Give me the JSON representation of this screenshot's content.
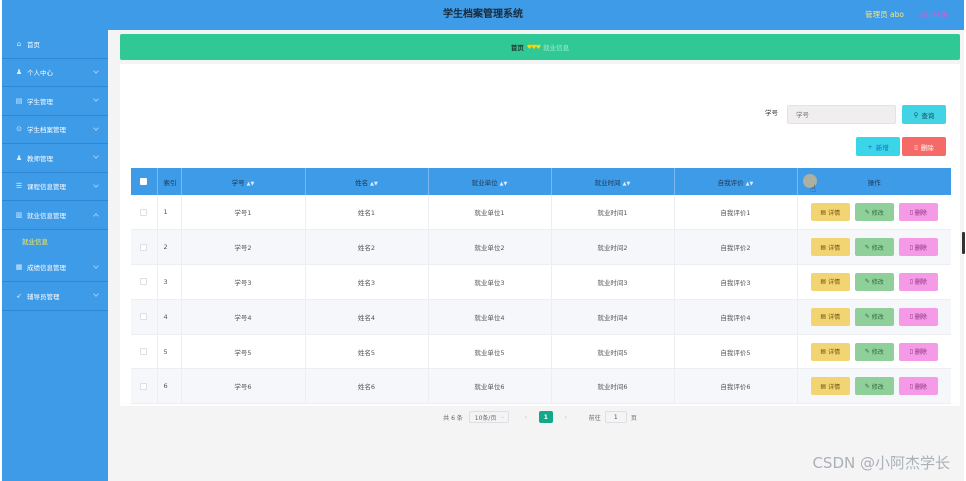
{
  "header": {
    "title": "学生档案管理系统",
    "user": "管理员 abo",
    "logout": "退出登录"
  },
  "sidebar": {
    "items": [
      {
        "label": "首页",
        "icon": "⌂"
      },
      {
        "label": "个人中心",
        "icon": "♟"
      },
      {
        "label": "学生管理",
        "icon": "▤"
      },
      {
        "label": "学生档案管理",
        "icon": "⊙"
      },
      {
        "label": "教师管理",
        "icon": "♟"
      },
      {
        "label": "课程信息管理",
        "icon": "☰"
      },
      {
        "label": "就业信息管理",
        "icon": "▥"
      }
    ],
    "sub_item": "就业信息",
    "items_after": [
      {
        "label": "成绩信息管理",
        "icon": "▦"
      },
      {
        "label": "辅导员管理",
        "icon": "➶"
      }
    ]
  },
  "breadcrumb": {
    "home": "首页",
    "current": "就业信息"
  },
  "search": {
    "label": "学号",
    "placeholder": "学号",
    "button": "查询"
  },
  "toolbar": {
    "add": "新增",
    "delete": "删除"
  },
  "table": {
    "columns": [
      "索引",
      "学号",
      "姓名",
      "就业单位",
      "就业时间",
      "自我评价",
      "操作"
    ],
    "actions": {
      "detail": "详情",
      "edit": "修改",
      "delete": "删除"
    },
    "rows": [
      {
        "index": "1",
        "student_no": "学号1",
        "name": "姓名1",
        "employer": "就业单位1",
        "employment_time": "就业时间1",
        "self_eval": "自我评价1"
      },
      {
        "index": "2",
        "student_no": "学号2",
        "name": "姓名2",
        "employer": "就业单位2",
        "employment_time": "就业时间2",
        "self_eval": "自我评价2"
      },
      {
        "index": "3",
        "student_no": "学号3",
        "name": "姓名3",
        "employer": "就业单位3",
        "employment_time": "就业时间3",
        "self_eval": "自我评价3"
      },
      {
        "index": "4",
        "student_no": "学号4",
        "name": "姓名4",
        "employer": "就业单位4",
        "employment_time": "就业时间4",
        "self_eval": "自我评价4"
      },
      {
        "index": "5",
        "student_no": "学号5",
        "name": "姓名5",
        "employer": "就业单位5",
        "employment_time": "就业时间5",
        "self_eval": "自我评价5"
      },
      {
        "index": "6",
        "student_no": "学号6",
        "name": "姓名6",
        "employer": "就业单位6",
        "employment_time": "就业时间6",
        "self_eval": "自我评价6"
      }
    ]
  },
  "pagination": {
    "total": "共 6 条",
    "page_size": "10条/页",
    "current_page": "1",
    "goto_label": "前往",
    "goto_value": "1",
    "page_unit": "页"
  },
  "watermark": "CSDN @小阿杰学长",
  "colors": {
    "header": "#3e9be8",
    "breadcrumb": "#30c996",
    "detail": "#f2d472",
    "edit": "#8fd09a",
    "delete": "#f49ae6"
  }
}
